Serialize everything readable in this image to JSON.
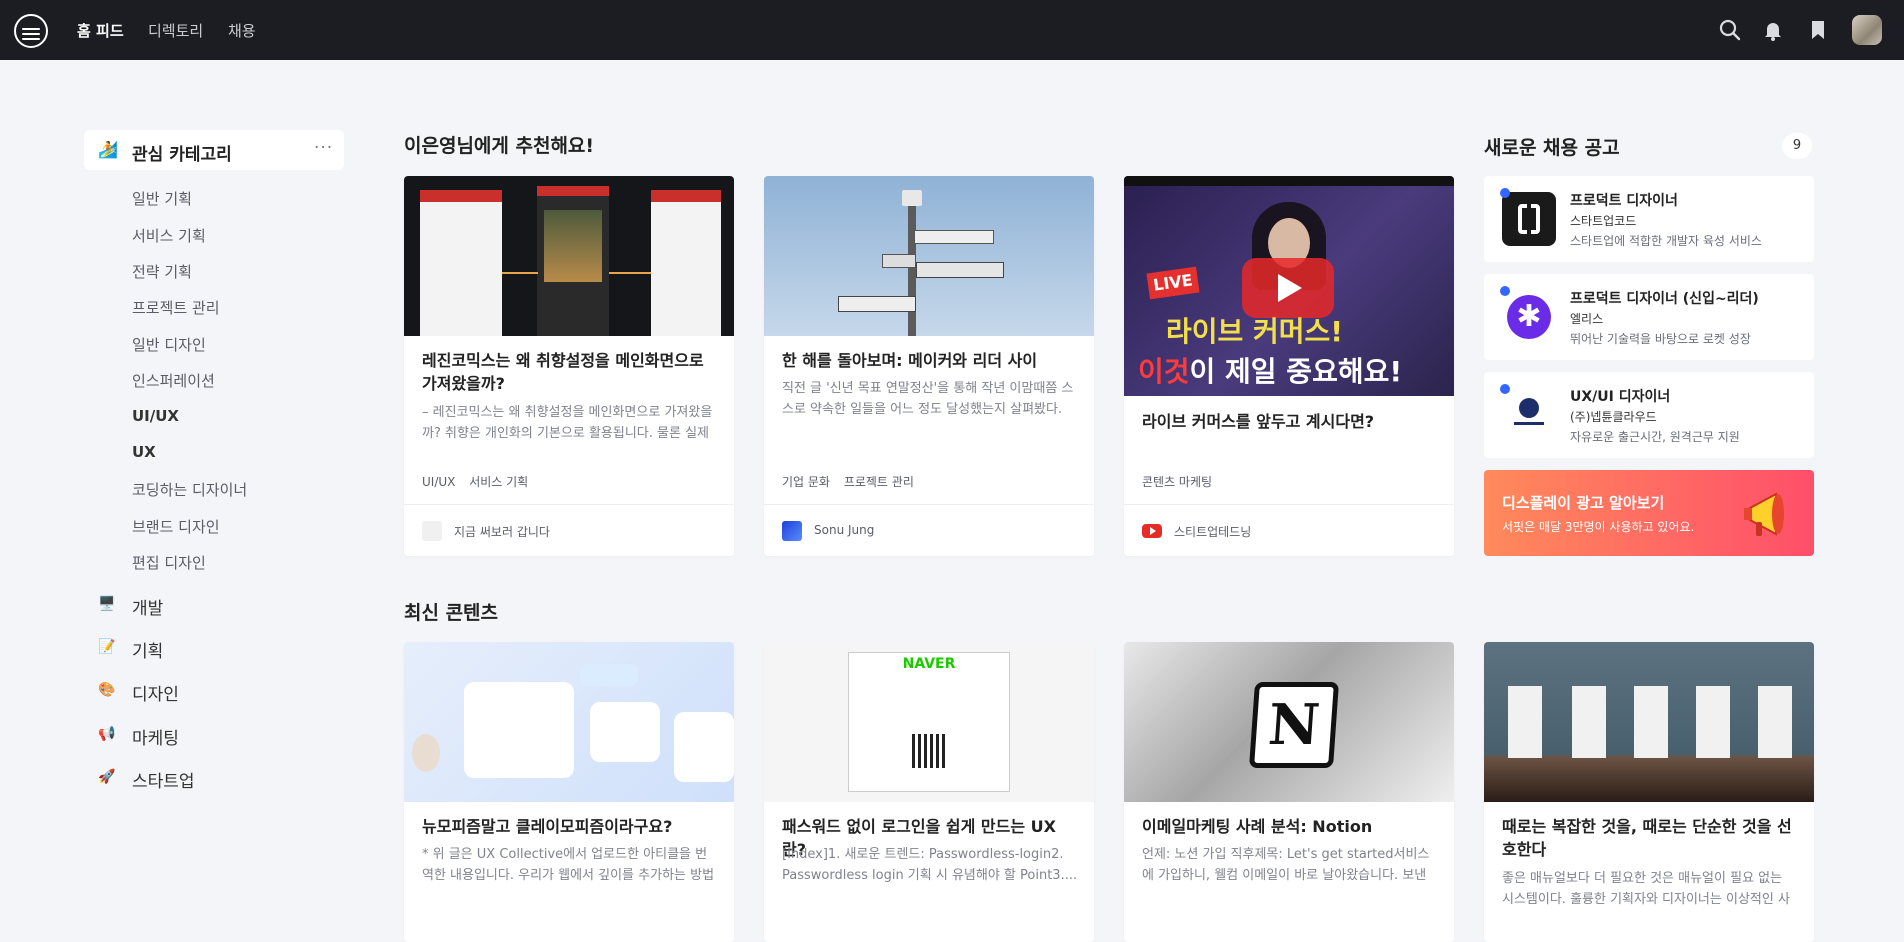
{
  "nav": {
    "links": [
      "홈 피드",
      "디렉토리",
      "채용"
    ],
    "icons": [
      "search-icon",
      "bell-icon",
      "bookmark-icon"
    ]
  },
  "sidebar": {
    "header": {
      "emoji": "🏄",
      "title": "관심 카테고리",
      "more": "···"
    },
    "sub_items": [
      "일반 기획",
      "서비스 기획",
      "전략 기획",
      "프로젝트 관리",
      "일반 디자인",
      "인스퍼레이션",
      "UI/UX",
      "UX",
      "코딩하는 디자이너",
      "브랜드 디자인",
      "편집 디자인"
    ],
    "categories": [
      {
        "icon": "🖥️",
        "label": "개발"
      },
      {
        "icon": "📝",
        "label": "기획"
      },
      {
        "icon": "🎨",
        "label": "디자인"
      },
      {
        "icon": "📢",
        "label": "마케팅"
      },
      {
        "icon": "🚀",
        "label": "스타트업"
      }
    ]
  },
  "recommended": {
    "title": "이은영님에게 추천해요!",
    "cards": [
      {
        "title": "레진코믹스는 왜 취향설정을 메인화면으로 가져왔을까?",
        "desc": "– 레진코믹스는 왜 취향설정을 메인화면으로 가져왔을까? 취향은 개인화의 기본으로 활용됩니다. 물론 실제 ...",
        "tags": [
          "UI/UX",
          "서비스 기획"
        ],
        "footer": "지금 써보러 갑니다"
      },
      {
        "title": "한 해를 돌아보며: 메이커와 리더 사이",
        "desc": "직전 글 '신년 목표 연말정산'을 통해 작년 이맘때쯤 스스로 약속한 일들을 어느 정도 달성했는지 살펴봤다. 그 ...",
        "tags": [
          "기업 문화",
          "프로젝트 관리"
        ],
        "footer": "Sonu Jung"
      },
      {
        "title": "라이브 커머스를 앞두고 계시다면?",
        "desc": "",
        "tags": [
          "콘텐츠 마케팅"
        ],
        "footer": "스티트업테드닝",
        "thumb_text": {
          "top": "라이브 커머스!",
          "bottom_red": "이것",
          "bottom_white": "이 제일 중요해요!",
          "live": "LIVE"
        }
      }
    ]
  },
  "latest": {
    "title": "최신 콘텐츠",
    "cards": [
      {
        "title": "뉴모피즘말고 클레이모피즘이라구요?",
        "desc": "* 위 글은 UX Collective에서 업로드한 아티클을 번역한 내용입니다. 우리가 웹에서 깊이를 추가하는 방법사..."
      },
      {
        "title": "패스워드 없이 로그인을 쉽게 만드는 UX란?",
        "desc": "[Index]1. 새로운 트렌드: Passwordless-login2. Passwordless login 기획 시 유념해야 할 Point3....",
        "thumb_text": "NAVER"
      },
      {
        "title": "이메일마케팅 사례 분석: Notion",
        "desc": "언제: 노션 가입 직후제목: Let's get started서비스에 가입하니, 웰컴 이메일이 바로 날아왔습니다. 보낸 이..."
      },
      {
        "title": "때로는 복잡한 것을, 때로는 단순한 것을 선호한다",
        "desc": "좋은 매뉴얼보다 더 필요한 것은 매뉴얼이 필요 없는 시스템이다. 훌륭한 기획자와 디자이너는 이상적인 사용..."
      }
    ]
  },
  "jobs": {
    "title": "새로운 채용 공고",
    "count": "9",
    "items": [
      {
        "title": "프로덕트 디자이너",
        "company": "스타트업코드",
        "desc": "스타트업에 적합한 개발자 육성 서비스"
      },
      {
        "title": "프로덕트 디자이너 (신입~리더)",
        "company": "엘리스",
        "desc": "뛰어난 기술력을 바탕으로 로켓 성장"
      },
      {
        "title": "UX/UI 디자이너",
        "company": "(주)넵튠클라우드",
        "desc": "자유로운 출근시간, 원격근무 지원"
      }
    ],
    "ad": {
      "title": "디스플레이 광고 알아보기",
      "desc": "서핏은 매달 3만명이 사용하고 있어요."
    }
  },
  "colors": {
    "nav_bg": "#1c1d22",
    "page_bg": "#f4f5f8",
    "accent_blue": "#3366ff",
    "ad_start": "#ff8a5b",
    "ad_end": "#ff4f6a"
  }
}
